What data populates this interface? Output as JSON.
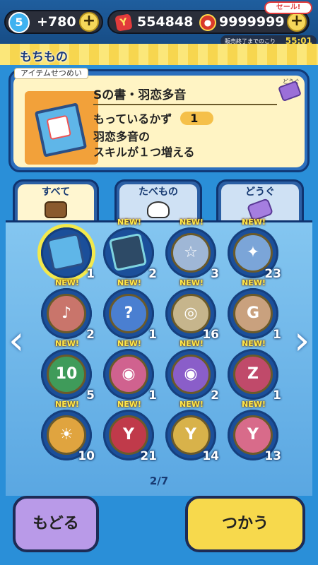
{
  "topbar": {
    "level": "5",
    "level_plus": "+780",
    "currency_amount": "554848",
    "gem_amount": "9999999",
    "sale_label": "セール!",
    "sale_remaining_label": "販売終了までのこり",
    "sale_time": "55:01",
    "icons": {
      "level": "level-badge-icon",
      "currency": "y-currency-icon",
      "gem": "medal-coin-icon",
      "plus": "plus-icon"
    }
  },
  "section": {
    "title": "もちもの"
  },
  "item_panel": {
    "caption": "アイテムせつめい",
    "name": "Sの書・羽恋多音",
    "category_tag": "どうぐ",
    "count_label": "もっているかず",
    "count_value": "1",
    "description_line1": "羽恋多音の",
    "description_line2": "スキルが１つ増える"
  },
  "tabs": [
    {
      "label": "すべて",
      "icon": "bag-icon",
      "active": true
    },
    {
      "label": "たべもの",
      "icon": "onigiri-icon",
      "active": false
    },
    {
      "label": "どうぐ",
      "icon": "ticket-icon",
      "active": false
    }
  ],
  "grid": {
    "new_label": "NEW!",
    "items": [
      {
        "qty": "1",
        "kind": "book"
      },
      {
        "qty": "2",
        "kind": "dark-book"
      },
      {
        "qty": "3",
        "kind": "star-coin"
      },
      {
        "qty": "23",
        "kind": "star-coin-blue"
      },
      {
        "qty": "2",
        "kind": "music-coin"
      },
      {
        "qty": "1",
        "kind": "question-coin"
      },
      {
        "qty": "16",
        "kind": "swirl-coin"
      },
      {
        "qty": "1",
        "kind": "g-coin"
      },
      {
        "qty": "5",
        "kind": "10-coin"
      },
      {
        "qty": "1",
        "kind": "swirl-pink-coin"
      },
      {
        "qty": "2",
        "kind": "swirl-purple-coin"
      },
      {
        "qty": "1",
        "kind": "zz-coin"
      },
      {
        "qty": "10",
        "kind": "sun-coin"
      },
      {
        "qty": "21",
        "kind": "y-red-coin"
      },
      {
        "qty": "14",
        "kind": "y-gold-coin"
      },
      {
        "qty": "13",
        "kind": "y-pink-coin"
      }
    ]
  },
  "pager": {
    "text": "2/7"
  },
  "buttons": {
    "back": "もどる",
    "use": "つかう"
  },
  "nav": {
    "left_arrow": "‹",
    "right_arrow": "›"
  }
}
